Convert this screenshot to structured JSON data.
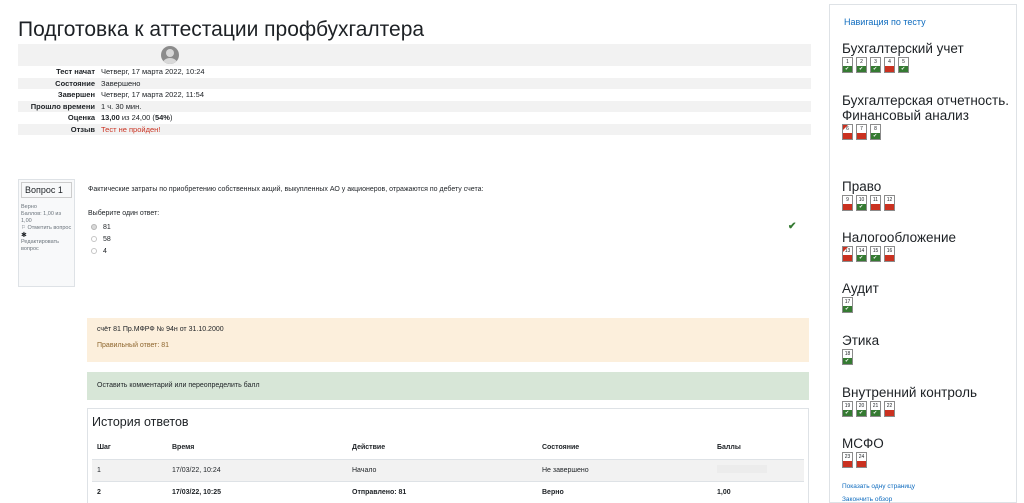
{
  "page_title": "Подготовка к аттестации профбухгалтера",
  "summary": [
    {
      "label": "Тест начат",
      "value": "Четверг, 17 марта 2022, 10:24"
    },
    {
      "label": "Состояние",
      "value": "Завершено"
    },
    {
      "label": "Завершен",
      "value": "Четверг, 17 марта 2022, 11:54"
    },
    {
      "label": "Прошло времени",
      "value": "1 ч. 30 мин."
    },
    {
      "label": "Оценка",
      "value_bold": "13,00",
      "value_rest": " из 24,00 (",
      "value_pct": "54%",
      "value_end": ")"
    },
    {
      "label": "Отзыв",
      "value": "Тест не пройден!"
    }
  ],
  "question": {
    "number_label": "Вопрос 1",
    "status": "Верно",
    "points": "Баллов: 1,00 из 1,00",
    "flag": "Отметить вопрос",
    "edit": "Редактировать вопрос",
    "text": "Фактические затраты по приобретению собственных акций, выкупленных АО у акционеров, отражаются по дебету счета:",
    "prompt": "Выберите один ответ:",
    "options": [
      "81",
      "58",
      "4"
    ],
    "selected_index": 0
  },
  "feedback": {
    "general": "счёт 81 Пр.МФРФ № 94н от 31.10.2000",
    "right_answer": "Правильный ответ: 81"
  },
  "comment_link": "Оставить комментарий или переопределить балл",
  "history": {
    "title": "История ответов",
    "headers": [
      "Шаг",
      "Время",
      "Действие",
      "Состояние",
      "Баллы"
    ],
    "rows": [
      [
        "1",
        "17/03/22, 10:24",
        "Начало",
        "Не завершено",
        ""
      ],
      [
        "2",
        "17/03/22, 10:25",
        "Отправлено: 81",
        "Верно",
        "1,00"
      ]
    ]
  },
  "nav": {
    "title": "Навигация по тесту",
    "sections": [
      {
        "title": "Бухгалтерский учет",
        "questions": [
          {
            "n": "1",
            "s": "ok"
          },
          {
            "n": "2",
            "s": "ok"
          },
          {
            "n": "3",
            "s": "ok"
          },
          {
            "n": "4",
            "s": "bad"
          },
          {
            "n": "5",
            "s": "ok"
          }
        ]
      },
      {
        "title": "Бухгалтерская отчетность. Финансовый анализ",
        "questions": [
          {
            "n": "6",
            "s": "bad",
            "flag": true
          },
          {
            "n": "7",
            "s": "bad"
          },
          {
            "n": "8",
            "s": "ok"
          }
        ]
      },
      {
        "title": "Право",
        "questions": [
          {
            "n": "9",
            "s": "bad"
          },
          {
            "n": "10",
            "s": "ok"
          },
          {
            "n": "11",
            "s": "bad"
          },
          {
            "n": "12",
            "s": "bad"
          }
        ]
      },
      {
        "title": "Налогообложение",
        "questions": [
          {
            "n": "13",
            "s": "bad",
            "flag": true
          },
          {
            "n": "14",
            "s": "ok"
          },
          {
            "n": "15",
            "s": "ok"
          },
          {
            "n": "16",
            "s": "bad"
          }
        ]
      },
      {
        "title": "Аудит",
        "questions": [
          {
            "n": "17",
            "s": "ok"
          }
        ]
      },
      {
        "title": "Этика",
        "questions": [
          {
            "n": "18",
            "s": "ok"
          }
        ]
      },
      {
        "title": "Внутренний контроль",
        "questions": [
          {
            "n": "19",
            "s": "ok"
          },
          {
            "n": "20",
            "s": "ok"
          },
          {
            "n": "21",
            "s": "ok"
          },
          {
            "n": "22",
            "s": "bad"
          }
        ]
      },
      {
        "title": "МСФО",
        "questions": [
          {
            "n": "23",
            "s": "bad"
          },
          {
            "n": "24",
            "s": "bad"
          }
        ]
      }
    ],
    "show_one_page": "Показать одну страницу",
    "finish_review": "Закончить обзор"
  },
  "colors": {
    "correct": "#357a32",
    "incorrect": "#ca3120",
    "link": "#0f6cbf"
  }
}
